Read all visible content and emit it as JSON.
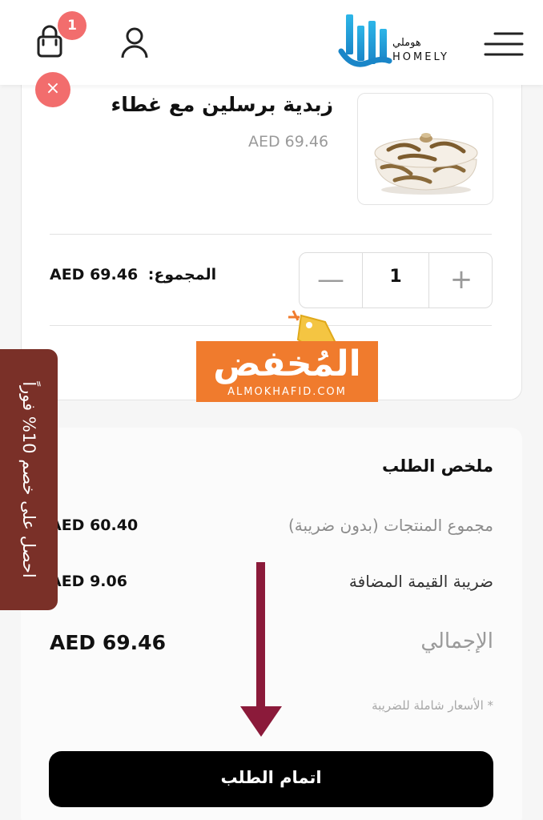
{
  "header": {
    "cart_count": "1",
    "logo": {
      "ar": "هوملي",
      "en": "HOMELY"
    }
  },
  "cart_item": {
    "name": "زبدية برسلين مع غطاء",
    "price": "AED 69.46",
    "remove_glyph": "×",
    "quantity": "1",
    "minus_glyph": "—",
    "plus_glyph": "+",
    "subtotal_label": "المجموع:",
    "subtotal_value": "AED 69.46"
  },
  "watermark": {
    "ar": "المُخفض",
    "en": "ALMOKHAFID.COM"
  },
  "promo": {
    "text": "احصل على خصم 10% فوراً"
  },
  "summary": {
    "title": "ملخص الطلب",
    "rows": [
      {
        "label": "مجموع المنتجات (بدون ضريبة)",
        "value": "AED 60.40"
      },
      {
        "label": "ضريبة القيمة المضافة",
        "value": "AED 9.06"
      }
    ],
    "total_label": "الإجمالي",
    "total_value": "AED 69.46",
    "note": "* الأسعار شاملة للضريبة",
    "checkout_label": "اتمام الطلب"
  },
  "colors": {
    "badge": "#f26d6d",
    "remove": "#f26d6d",
    "promo_bg": "#7a3028",
    "arrow": "#8b1a3a",
    "watermark_bg": "#f07b2d",
    "checkout_bg": "#000000"
  },
  "icons": [
    "shopping-bag-icon",
    "user-icon",
    "menu-icon",
    "close-icon",
    "minus-icon",
    "plus-icon",
    "arrow-down-icon"
  ]
}
